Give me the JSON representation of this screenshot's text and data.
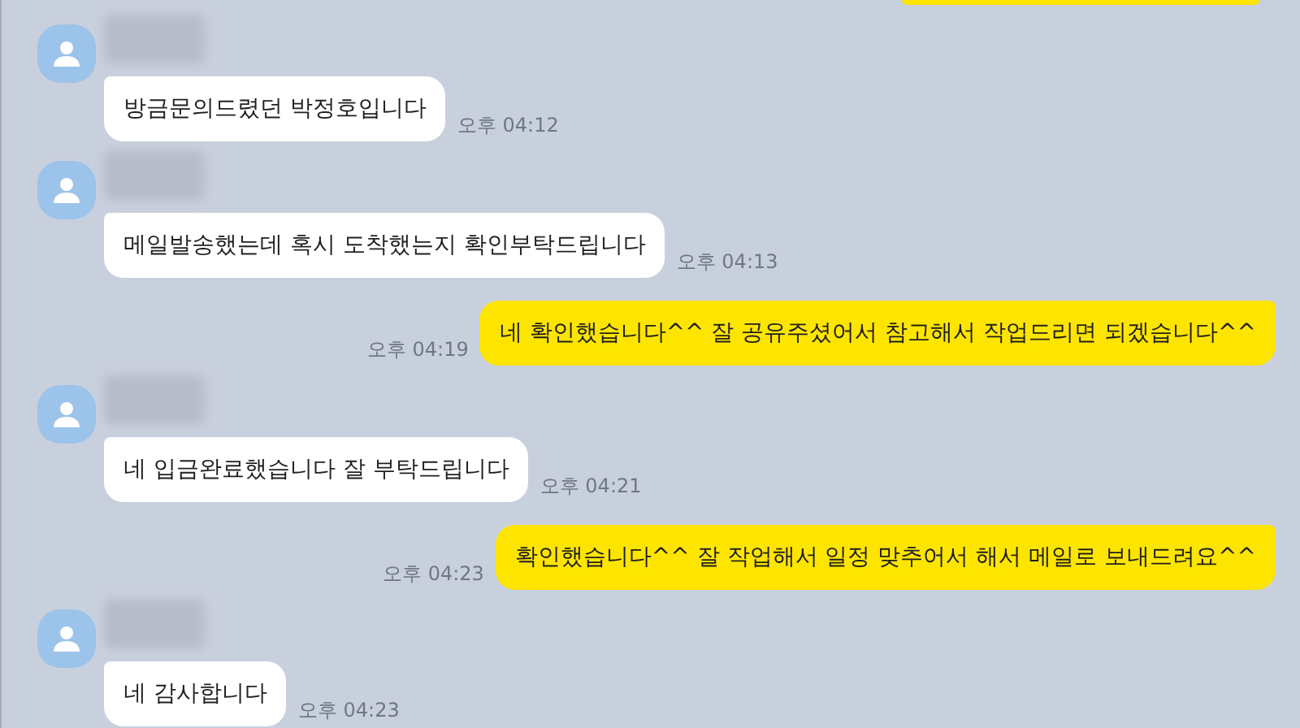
{
  "messages": [
    {
      "kind": "sent_clipped"
    },
    {
      "kind": "received",
      "text": "방금문의드렸던 박정호입니다",
      "time": "오후 04:12"
    },
    {
      "kind": "received",
      "text": "메일발송했는데 혹시 도착했는지 확인부탁드립니다",
      "time": "오후 04:13"
    },
    {
      "kind": "sent",
      "text": "네 확인했습니다^^ 잘 공유주셨어서 참고해서 작업드리면 되겠습니다^^",
      "time": "오후 04:19"
    },
    {
      "kind": "received",
      "text": "네 입금완료했습니다 잘 부탁드립니다",
      "time": "오후 04:21"
    },
    {
      "kind": "sent",
      "text": "확인했습니다^^ 잘 작업해서 일정 맞추어서 해서 메일로 보내드려요^^",
      "time": "오후 04:23"
    },
    {
      "kind": "received",
      "text": "네 감사합니다",
      "time": "오후 04:23"
    }
  ]
}
